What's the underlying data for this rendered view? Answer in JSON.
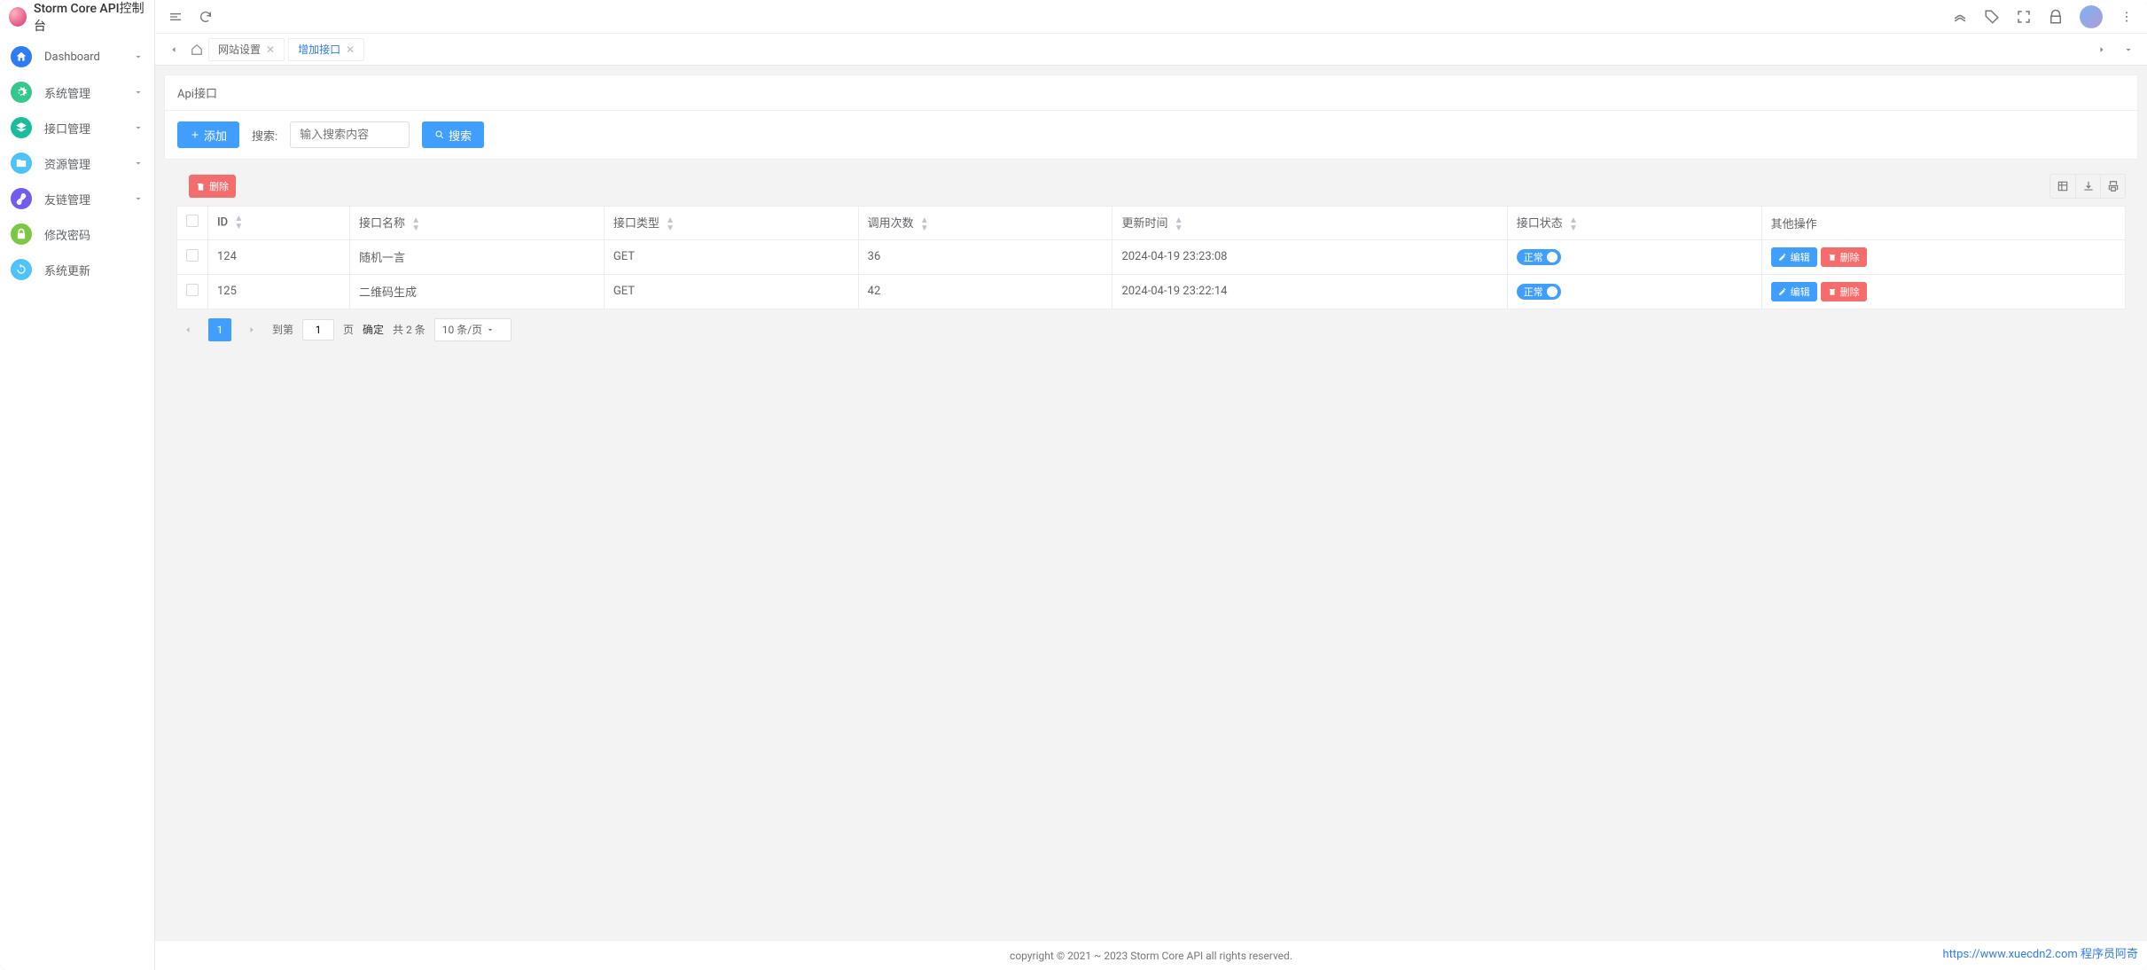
{
  "app_title": "Storm Core API控制台",
  "sidebar": {
    "items": [
      {
        "label": "Dashboard",
        "expandable": true
      },
      {
        "label": "系统管理",
        "expandable": true
      },
      {
        "label": "接口管理",
        "expandable": true
      },
      {
        "label": "资源管理",
        "expandable": true
      },
      {
        "label": "友链管理",
        "expandable": true
      },
      {
        "label": "修改密码",
        "expandable": false
      },
      {
        "label": "系统更新",
        "expandable": false
      }
    ]
  },
  "tabs": [
    {
      "label": "网站设置",
      "active": false
    },
    {
      "label": "增加接口",
      "active": true
    }
  ],
  "page": {
    "title": "Api接口",
    "add_btn": "添加",
    "search_label": "搜索:",
    "search_placeholder": "输入搜索内容",
    "search_btn": "搜索",
    "delete_btn": "删除"
  },
  "table": {
    "columns": [
      "ID",
      "接口名称",
      "接口类型",
      "调用次数",
      "更新时间",
      "接口状态",
      "其他操作"
    ],
    "status_label": "正常",
    "edit_btn": "编辑",
    "row_delete_btn": "删除",
    "rows": [
      {
        "id": "124",
        "name": "随机一言",
        "type": "GET",
        "calls": "36",
        "time": "2024-04-19 23:23:08"
      },
      {
        "id": "125",
        "name": "二维码生成",
        "type": "GET",
        "calls": "42",
        "time": "2024-04-19 23:22:14"
      }
    ]
  },
  "pagination": {
    "current": "1",
    "goto_label": "到第",
    "goto_value": "1",
    "page_label": "页",
    "confirm_btn": "确定",
    "total_text": "共 2 条",
    "page_size": "10 条/页"
  },
  "footer": "copyright © 2021 ~ 2023 Storm Core API all rights reserved.",
  "watermark": "https://www.xuecdn2.com   程序员阿奇"
}
